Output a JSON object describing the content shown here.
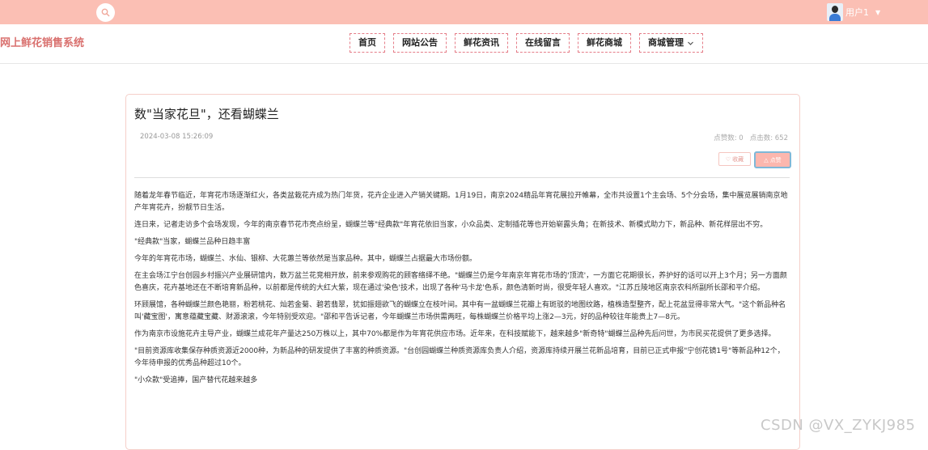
{
  "header": {
    "user_name": "用户1"
  },
  "site": {
    "title": "网上鲜花销售系统"
  },
  "nav": {
    "items": [
      {
        "label": "首页"
      },
      {
        "label": "网站公告"
      },
      {
        "label": "鲜花资讯"
      },
      {
        "label": "在线留言"
      },
      {
        "label": "鲜花商城"
      },
      {
        "label": "商城管理"
      }
    ]
  },
  "article": {
    "title": "数\"当家花旦\"，还看蝴蝶兰",
    "date": "2024-03-08 15:26:09",
    "like_count_label": "点赞数: 0",
    "click_count_label": "点击数: 652",
    "fav_label": "收藏",
    "like_label": "点赞",
    "paragraphs": [
      "随着龙年春节临近，年宵花市场逐渐红火，各类盆栽花卉成为热门年货，花卉企业进入产销关键期。1月19日，南京2024精品年宵花展拉开帷幕，全市共设置1个主会场、5个分会场，集中展览展销南京地产年宵花卉，扮靓节日生活。",
      "连日来，记者走访多个会场发现，今年的南京春节花市亮点纷呈，蝴蝶兰等\"经典款\"年宵花依旧当家，小众品类、定制插花等也开始崭露头角；在新技术、新模式助力下，新品种、新花样层出不穷。",
      "\"经典款\"当家，蝴蝶兰品种日趋丰富",
      "今年的年宵花市场，蝴蝶兰、水仙、银柳、大花蕙兰等依然是当家品种。其中，蝴蝶兰占据最大市场份额。",
      "在主会场江宁台创园乡村振兴产业展研馆内，数万盆兰花竞相开放，前来参观购花的顾客络绎不绝。\"蝴蝶兰仍是今年南京年宵花市场的'顶流'，一方面它花期很长，养护好的话可以开上3个月；另一方面颜色喜庆，花卉基地还在不断培育新品种，以前都是传统的大红大紫，现在通过'染色'技术，出现了各种'马卡龙'色系，颜色清新时尚，很受年轻人喜欢。\"江苏丘陵地区南京农科所副所长邵和平介绍。",
      "环顾展馆，各种蝴蝶兰颜色艳丽，粉若桃花、灿若金菊、碧若翡翠，犹如振翅欲飞的蝴蝶立在枝叶间。其中有一盆蝴蝶兰花瓣上有斑驳的地图纹路，植株造型整齐，配上花盆显得非常大气。\"这个新品种名叫'藏宝图'，寓意蕴藏宝藏、财源滚滚，今年特别受欢迎。\"邵和平告诉记者，今年蝴蝶兰市场供需两旺，每株蝴蝶兰价格平均上涨2—3元，好的品种较往年能贵上7—8元。",
      "作为南京市设施花卉主导产业，蝴蝶兰成花年产量达250万株以上，其中70%都是作为年宵花供应市场。近年来，在科技赋能下，越来越多\"新奇特\"蝴蝶兰品种先后问世，为市民买花提供了更多选择。",
      "\"目前资源库收集保存种质资源近2000种，为新品种的研发提供了丰富的种质资源。\"台创园蝴蝶兰种质资源库负责人介绍，资源库持续开展兰花新品培育，目前已正式申报\"宁创花镜1号\"等新品种12个，今年待申报的优秀品种超过10个。",
      "\"小众款\"受追捧，国产替代花越来越多"
    ]
  },
  "watermark": "CSDN @VX_ZYKJ985"
}
